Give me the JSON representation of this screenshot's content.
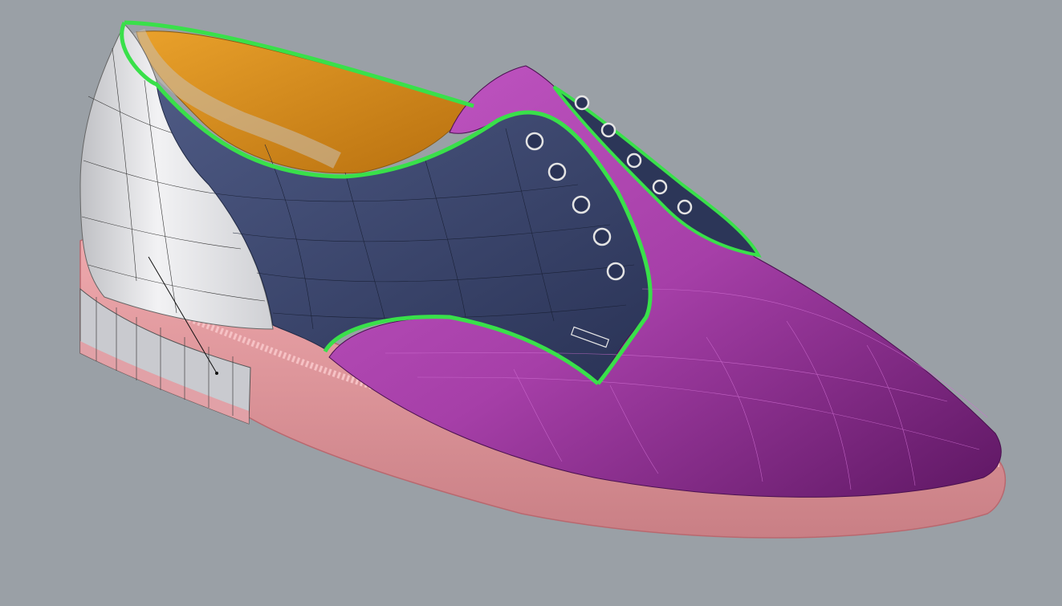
{
  "viewport": {
    "background": "#9aa0a6",
    "model": "oxford-shoe"
  },
  "colors": {
    "sole": "#e59aa0",
    "sole_edge": "#f4b6b9",
    "vamp": "#a63fa8",
    "vamp_dark": "#6a1a6e",
    "quarter": "#3a4670",
    "heel_counter": "#d9d9dc",
    "lining": "#d9921c",
    "trim": "#39e04a",
    "wire": "#2a2a2a"
  }
}
